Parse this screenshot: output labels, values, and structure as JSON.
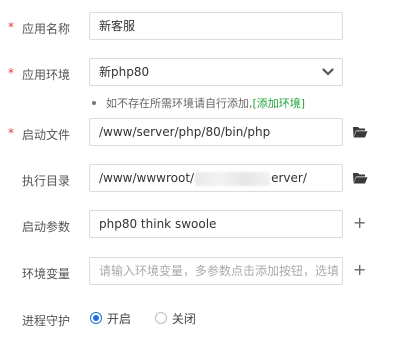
{
  "form": {
    "app_name": {
      "label": "应用名称",
      "required_mark": "*",
      "value": "新客服"
    },
    "app_env": {
      "label": "应用环境",
      "required_mark": "*",
      "selected": "新php80",
      "hint_text": "如不存在所需环境请自行添加,",
      "hint_link": "[添加环境]"
    },
    "start_file": {
      "label": "启动文件",
      "required_mark": "*",
      "value": "/www/server/php/80/bin/php",
      "icon": "folder-open-icon"
    },
    "exec_dir": {
      "label": "执行目录",
      "value_prefix": "/www/wwwroot/",
      "value_suffix": "erver/",
      "icon": "folder-open-icon"
    },
    "start_params": {
      "label": "启动参数",
      "value": "php80 think swoole",
      "add": "+"
    },
    "env_vars": {
      "label": "环境变量",
      "placeholder": "请输入环境变量，多参数点击添加按钮，选填",
      "add": "+"
    },
    "daemon": {
      "label": "进程守护",
      "options": [
        "开启",
        "关闭"
      ],
      "selected": "开启"
    }
  },
  "colors": {
    "required": "#e0393e",
    "link": "#20a53a",
    "radio_active": "#1e6fd9"
  }
}
